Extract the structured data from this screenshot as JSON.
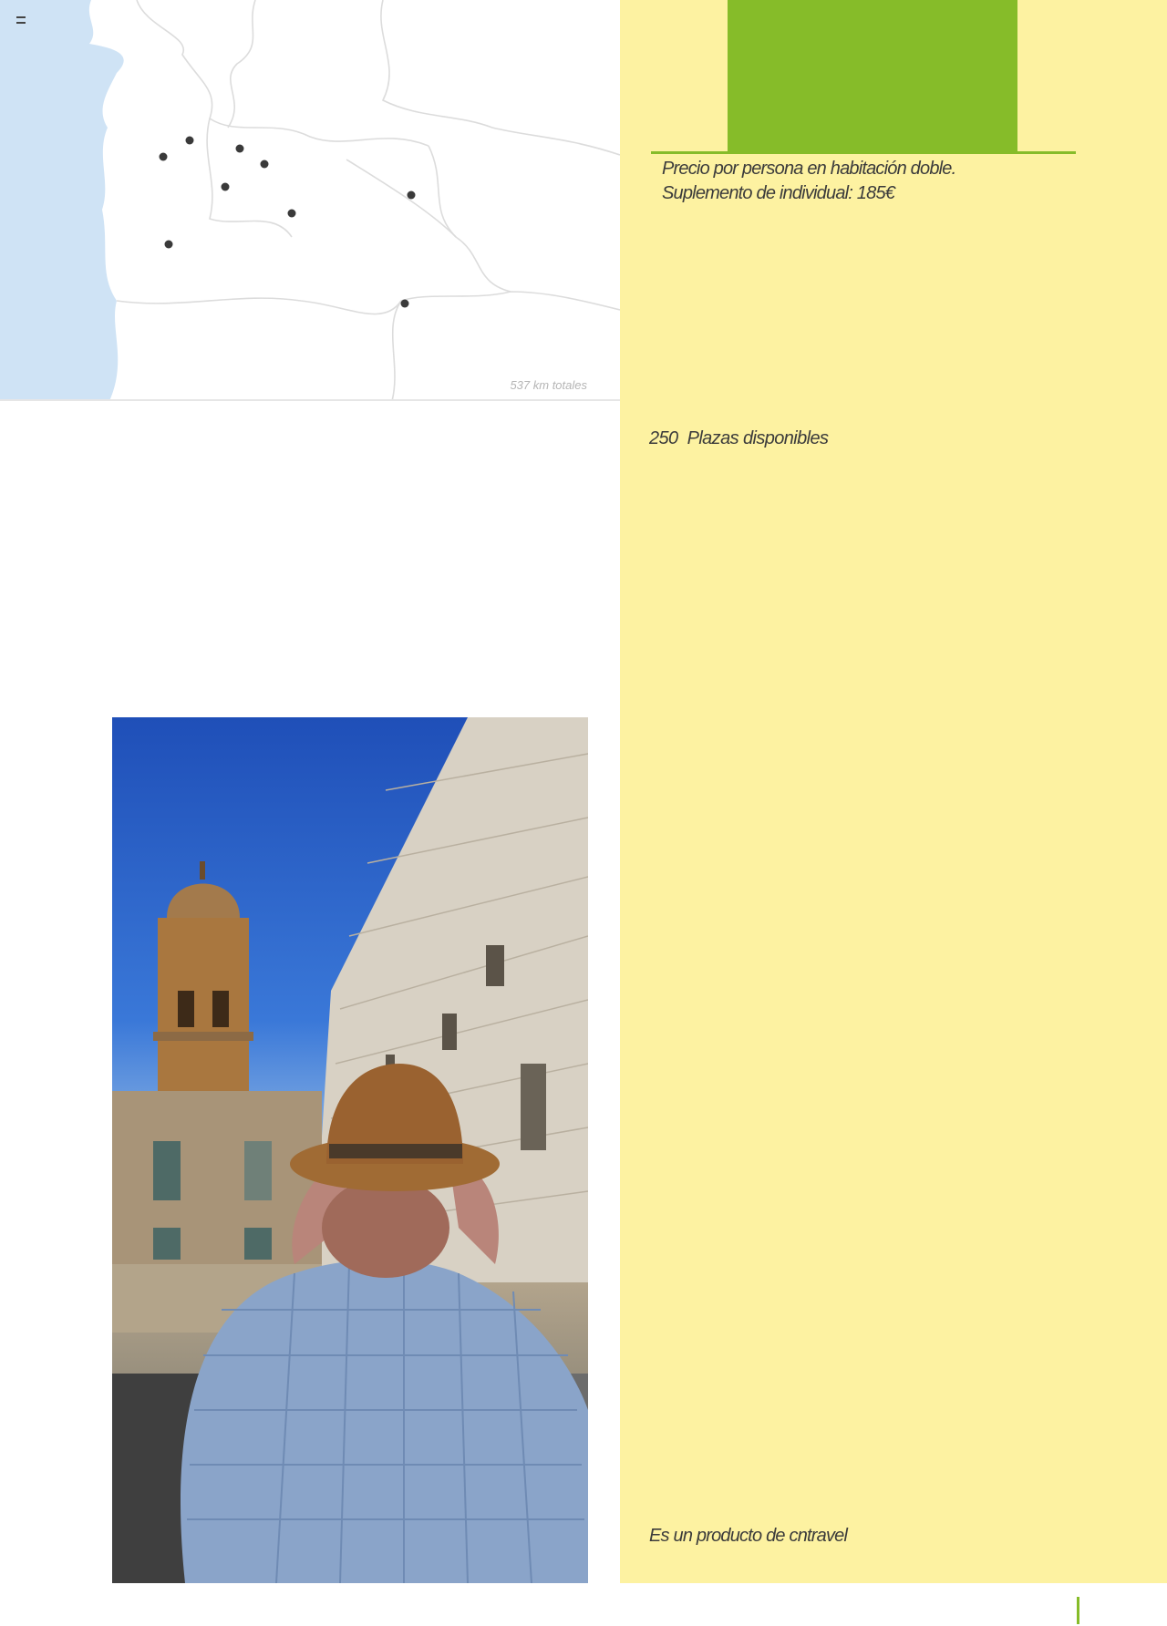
{
  "colors": {
    "panel_bg": "#fdf2a1",
    "accent_green": "#86bc29",
    "map_sea": "#cfe3f5",
    "text": "#3b3b3b"
  },
  "map": {
    "caption": "537 km totales",
    "icon": "map-dots-icon"
  },
  "pricing": {
    "note_line1": "Precio por persona en habitación doble.",
    "note_line2": "Suplemento de individual: 185€"
  },
  "availability": {
    "seats": "250",
    "label": "Plazas disponibles"
  },
  "footer": {
    "producer": "Es un producto de cntravel"
  },
  "photo": {
    "icon": "photo-man-with-hat-icon"
  }
}
